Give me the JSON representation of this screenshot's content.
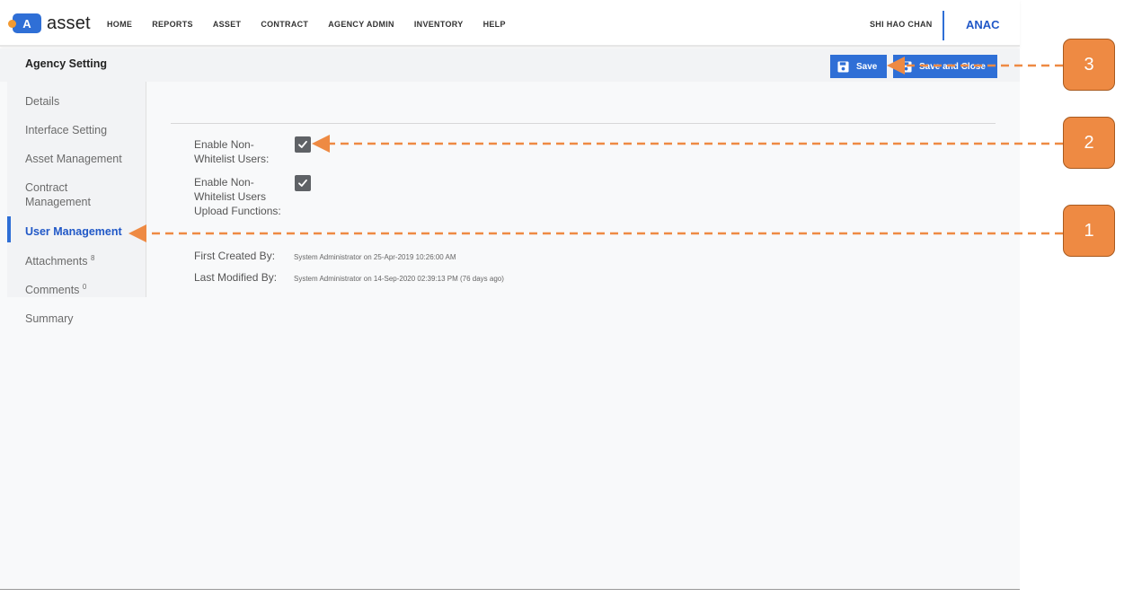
{
  "app": {
    "name": "asset",
    "logo_letter": "A"
  },
  "nav": {
    "items": [
      "HOME",
      "REPORTS",
      "ASSET",
      "CONTRACT",
      "AGENCY ADMIN",
      "INVENTORY",
      "HELP"
    ],
    "user_name": "SHI HAO CHAN",
    "org_code": "ANAC"
  },
  "header": {
    "title": "Agency Setting",
    "save_label": "Save",
    "save_close_label": "Save and Close"
  },
  "sidebar": {
    "items": [
      {
        "label": "Details",
        "count": ""
      },
      {
        "label": "Interface Setting",
        "count": ""
      },
      {
        "label": "Asset Management",
        "count": ""
      },
      {
        "label": "Contract",
        "label2": "Management",
        "count": ""
      },
      {
        "label": "User Management",
        "count": ""
      },
      {
        "label": "Attachments",
        "count": "8"
      },
      {
        "label": "Comments",
        "count": "0"
      }
    ],
    "summary": "Summary",
    "active": "User Management"
  },
  "form": {
    "field1": {
      "line1": "Enable Non-",
      "line2": "Whitelist Users:",
      "checked": true
    },
    "field2": {
      "line1": "Enable Non-",
      "line2": "Whitelist Users",
      "line3": "Upload Functions:",
      "checked": true
    }
  },
  "meta": {
    "created_label": "First Created By:",
    "created_value": "System Administrator on 25-Apr-2019 10:26:00 AM",
    "modified_label": "Last Modified By:",
    "modified_value": "System Administrator on 14-Sep-2020 02:39:13 PM (76 days ago)"
  },
  "annotations": [
    "1",
    "2",
    "3"
  ],
  "colors": {
    "primary": "#2f6fd6",
    "accent": "#ee8a43",
    "link": "#2158c7"
  }
}
